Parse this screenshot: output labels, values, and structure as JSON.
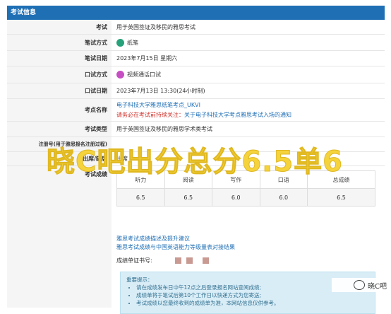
{
  "section_title": "考试信息",
  "rows": {
    "exam": {
      "label": "考试",
      "value": "用于英国签证及移民的雅思考试"
    },
    "written_method": {
      "label": "笔试方式",
      "value": "纸笔"
    },
    "written_date": {
      "label": "笔试日期",
      "value": "2023年7月15日 星期六"
    },
    "speaking_method": {
      "label": "口试方式",
      "value": "视频通话口试"
    },
    "speaking_date": {
      "label": "口试日期",
      "value": "2023年7月13日 13:30(24小时制)"
    },
    "test_center": {
      "label": "考点名称",
      "name": "电子科技大学雅思纸笔考点_UKVI",
      "warn_prefix": "请务必在考试前持续关注：",
      "warn_link": "关于电子科技大学考点雅思考试入场的通知"
    },
    "exam_type": {
      "label": "考试类型",
      "value": "用于英国签证及移民的雅思学术类考试"
    },
    "reg_no": {
      "label": "注册号(用于雅思报名注册过程)",
      "value": ""
    },
    "attendance": {
      "label": "出席/缺席",
      "value": "出席"
    },
    "scores": {
      "label": "考试成绩",
      "headers": [
        "听力",
        "阅读",
        "写作",
        "口语",
        "总成绩"
      ],
      "values": [
        "6.5",
        "6.5",
        "6.0",
        "6.0",
        "6.5"
      ],
      "link1": "雅思考试成绩描述及提升建议",
      "link2": "雅思考试成绩与中国英语能力等级量表对接结果",
      "cert_label": "成绩单证书号:"
    }
  },
  "notice": {
    "title": "重要提示：",
    "items": [
      "请在成绩发布日中午12点之后登录报名网站查阅成绩;",
      "成绩单将于笔试后第10个工作日以快递方式为您寄送;",
      "考试成绩以您最终收到的成绩单为准，本网站信息仅供参考。"
    ]
  },
  "overlay_text": "晓C吧出分总分6.5单6",
  "brand": "晓C吧",
  "colors": {
    "header": "#1f6fb5",
    "link": "#1f6fb5",
    "warn": "#d0332b",
    "overlay": "#f5d33d",
    "notice_bg": "#d9edf7"
  }
}
